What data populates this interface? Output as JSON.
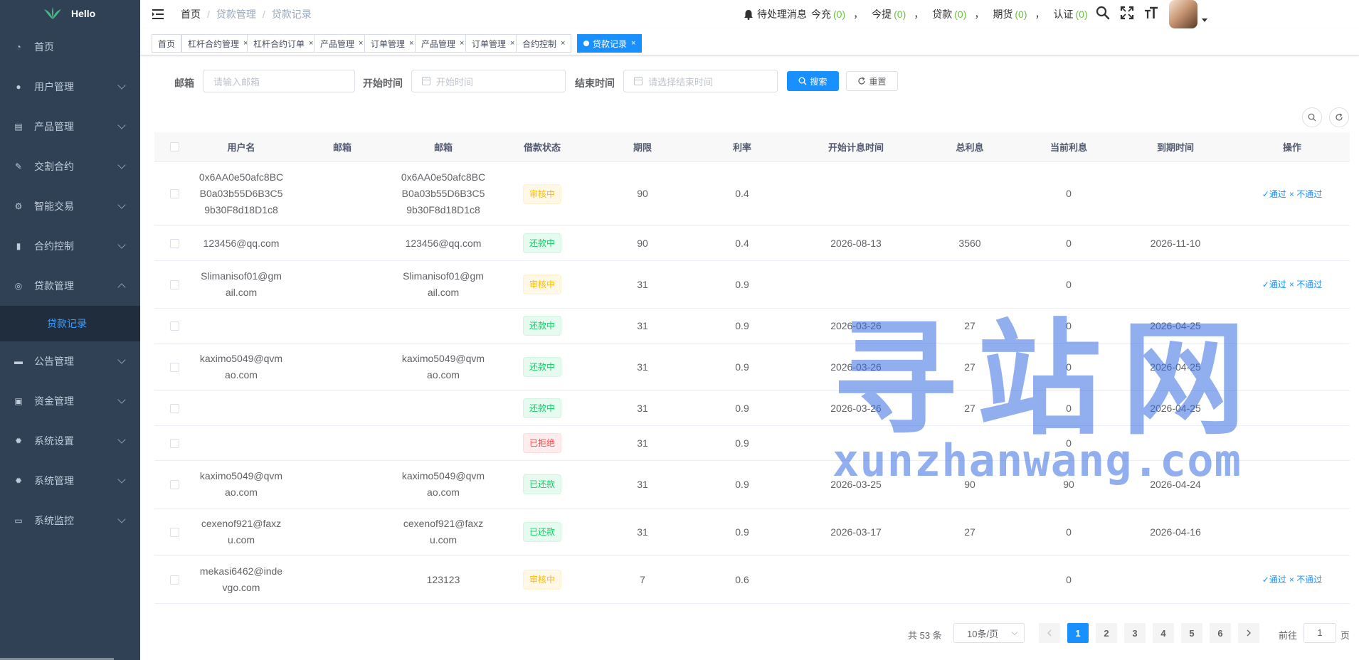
{
  "brand": {
    "title": "Hello"
  },
  "sidebar": {
    "items": [
      {
        "label": "首页",
        "icon": "dashboard-icon",
        "arrow": false
      },
      {
        "label": "用户管理",
        "icon": "user-icon",
        "arrow": true
      },
      {
        "label": "产品管理",
        "icon": "document-icon",
        "arrow": true
      },
      {
        "label": "交割合约",
        "icon": "edit-icon",
        "arrow": true
      },
      {
        "label": "智能交易",
        "icon": "gear-icon",
        "arrow": true
      },
      {
        "label": "合约控制",
        "icon": "chart-icon",
        "arrow": true
      },
      {
        "label": "贷款管理",
        "icon": "loan-icon",
        "arrow": true,
        "open": true
      },
      {
        "label": "公告管理",
        "icon": "message-icon",
        "arrow": true
      },
      {
        "label": "资金管理",
        "icon": "money-icon",
        "arrow": true
      },
      {
        "label": "系统设置",
        "icon": "settings-icon",
        "arrow": true
      },
      {
        "label": "系统管理",
        "icon": "settings-icon",
        "arrow": true
      },
      {
        "label": "系统监控",
        "icon": "monitor-icon",
        "arrow": true
      }
    ],
    "submenu_active": "贷款记录"
  },
  "breadcrumb": {
    "home": "首页",
    "level2": "贷款管理",
    "level3": "贷款记录",
    "sep": "/"
  },
  "notice": {
    "prefix": "待处理消息",
    "items": [
      {
        "label": "今充",
        "count": "(0)"
      },
      {
        "label": "今提",
        "count": "(0)"
      },
      {
        "label": "贷款",
        "count": "(0)"
      },
      {
        "label": "期货",
        "count": "(0)"
      },
      {
        "label": "认证",
        "count": "(0)"
      }
    ],
    "comma": "，"
  },
  "tags": [
    {
      "label": "首页",
      "closable": false
    },
    {
      "label": "杠杆合约管理",
      "closable": true
    },
    {
      "label": "杠杆合约订单",
      "closable": true
    },
    {
      "label": "产品管理",
      "closable": true
    },
    {
      "label": "订单管理",
      "closable": true
    },
    {
      "label": "产品管理",
      "closable": true
    },
    {
      "label": "订单管理",
      "closable": true
    },
    {
      "label": "合约控制",
      "closable": true
    },
    {
      "label": "贷款记录",
      "closable": true,
      "active": true
    }
  ],
  "tag_close": "×",
  "form": {
    "email_label": "邮箱",
    "email_placeholder": "请输入邮箱",
    "start_label": "开始时间",
    "start_placeholder": "开始时间",
    "end_label": "结束时间",
    "end_placeholder": "请选择结束时间",
    "search_btn": "搜索",
    "reset_btn": "重置"
  },
  "table": {
    "headers": [
      "用户名",
      "邮箱",
      "邮箱",
      "借款状态",
      "期限",
      "利率",
      "开始计息时间",
      "总利息",
      "当前利息",
      "到期时间",
      "操作"
    ],
    "approve": "✓通过",
    "reject": "× 不通过",
    "rows": [
      {
        "username": "0x6AA0e50afc8BCB0a03b55D6B3C59b30F8d18D1c8",
        "email1": "",
        "email2": "0x6AA0e50afc8BCB0a03b55D6B3C59b30F8d18D1c8",
        "status": "审核中",
        "status_type": "warn",
        "term": "90",
        "rate": "0.4",
        "start": "",
        "total": "",
        "current": "0",
        "due": "",
        "ops": true
      },
      {
        "username": "123456@qq.com",
        "email1": "",
        "email2": "123456@qq.com",
        "status": "还款中",
        "status_type": "ok",
        "term": "90",
        "rate": "0.4",
        "start": "2026-08-13",
        "total": "3560",
        "current": "0",
        "due": "2026-11-10",
        "ops": false
      },
      {
        "username": "Slimanisof01@gmail.com",
        "email1": "",
        "email2": "Slimanisof01@gmail.com",
        "status": "审核中",
        "status_type": "warn",
        "term": "31",
        "rate": "0.9",
        "start": "",
        "total": "",
        "current": "0",
        "due": "",
        "ops": true
      },
      {
        "username": "",
        "email1": "",
        "email2": "",
        "status": "还款中",
        "status_type": "ok",
        "term": "31",
        "rate": "0.9",
        "start": "2026-03-26",
        "total": "27",
        "current": "0",
        "due": "2026-04-25",
        "ops": false
      },
      {
        "username": "kaximo5049@qvmao.com",
        "email1": "",
        "email2": "kaximo5049@qvmao.com",
        "status": "还款中",
        "status_type": "ok",
        "term": "31",
        "rate": "0.9",
        "start": "2026-03-26",
        "total": "27",
        "current": "0",
        "due": "2026-04-25",
        "ops": false
      },
      {
        "username": "",
        "email1": "",
        "email2": "",
        "status": "还款中",
        "status_type": "ok",
        "term": "31",
        "rate": "0.9",
        "start": "2026-03-26",
        "total": "27",
        "current": "0",
        "due": "2026-04-25",
        "ops": false
      },
      {
        "username": "",
        "email1": "",
        "email2": "",
        "status": "已拒绝",
        "status_type": "err",
        "term": "31",
        "rate": "0.9",
        "start": "",
        "total": "",
        "current": "0",
        "due": "",
        "ops": false
      },
      {
        "username": "kaximo5049@qvmao.com",
        "email1": "",
        "email2": "kaximo5049@qvmao.com",
        "status": "已还款",
        "status_type": "ok",
        "term": "31",
        "rate": "0.9",
        "start": "2026-03-25",
        "total": "90",
        "current": "90",
        "due": "2026-04-24",
        "ops": false
      },
      {
        "username": "cexenof921@faxzu.com",
        "email1": "",
        "email2": "cexenof921@faxzu.com",
        "status": "已还款",
        "status_type": "ok",
        "term": "31",
        "rate": "0.9",
        "start": "2026-03-17",
        "total": "27",
        "current": "0",
        "due": "2026-04-16",
        "ops": false
      },
      {
        "username": "mekasi6462@indevgo.com",
        "email1": "",
        "email2": "123123",
        "status": "审核中",
        "status_type": "warn",
        "term": "7",
        "rate": "0.6",
        "start": "",
        "total": "",
        "current": "0",
        "due": "",
        "ops": true
      }
    ]
  },
  "pagination": {
    "total": "共 53 条",
    "page_size": "10条/页",
    "pages": [
      "1",
      "2",
      "3",
      "4",
      "5",
      "6"
    ],
    "current": "1",
    "goto_label": "前往",
    "goto_value": "1",
    "goto_unit": "页"
  },
  "watermark": {
    "cn": "寻站网",
    "en": "xunzhanwang.com"
  },
  "colors": {
    "sidebar_bg": "#304156",
    "accent": "#1890ff",
    "success": "#13ce66",
    "warning": "#ffba00",
    "danger": "#ff4949",
    "count": "#67c23a"
  }
}
